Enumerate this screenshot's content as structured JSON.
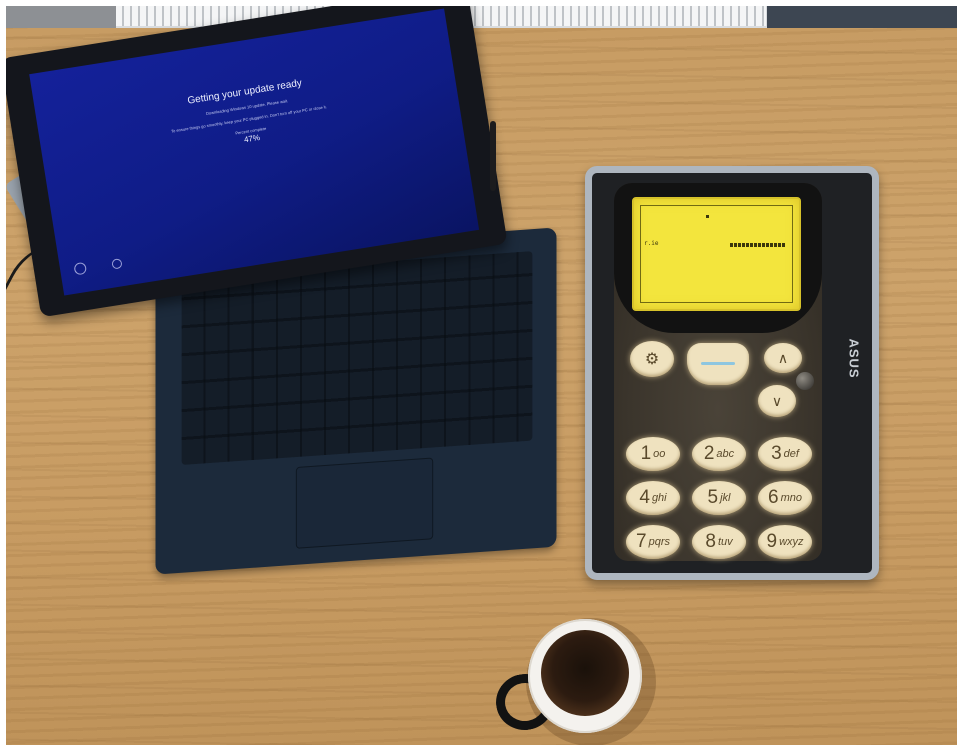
{
  "laptop": {
    "update_title": "Getting your update ready",
    "update_line1": "Downloading Windows 10 update. Please wait.",
    "update_line2": "To ensure things go smoothly, keep your PC plugged in. Don't turn off your PC or close it.",
    "progress_label": "Percent complete",
    "progress_text": "47%",
    "progress_value": 47
  },
  "tablet": {
    "brand": "ASUS",
    "screen_colors": {
      "lcd": "#f3e53d",
      "keys": "#efe2bf"
    },
    "game": {
      "score": "r.ie"
    },
    "keypad": [
      {
        "num": "1",
        "letters": "oo"
      },
      {
        "num": "2",
        "letters": "abc"
      },
      {
        "num": "3",
        "letters": "def"
      },
      {
        "num": "4",
        "letters": "ghi"
      },
      {
        "num": "5",
        "letters": "jkl"
      },
      {
        "num": "6",
        "letters": "mno"
      },
      {
        "num": "7",
        "letters": "pqrs"
      },
      {
        "num": "8",
        "letters": "tuv"
      },
      {
        "num": "9",
        "letters": "wxyz"
      }
    ]
  }
}
